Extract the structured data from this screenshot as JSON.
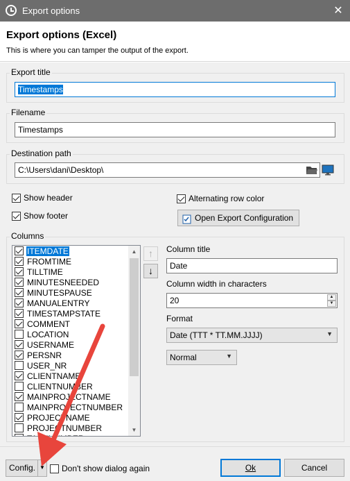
{
  "window": {
    "title": "Export options",
    "close_glyph": "✕"
  },
  "header": {
    "title": "Export options (Excel)",
    "description": "This is where you can tamper the output of the export."
  },
  "export_title": {
    "label": "Export title",
    "value": "Timestamps"
  },
  "filename": {
    "label": "Filename",
    "value": "Timestamps"
  },
  "destination": {
    "label": "Destination path",
    "value": "C:\\Users\\dani\\Desktop\\"
  },
  "options": {
    "show_header": "Show header",
    "show_footer": "Show footer",
    "alternating_row_color": "Alternating row color",
    "open_export_config": "Open Export Configuration"
  },
  "columns": {
    "label": "Columns",
    "items": [
      {
        "name": "ITEMDATE",
        "checked": true,
        "selected": true
      },
      {
        "name": "FROMTIME",
        "checked": true
      },
      {
        "name": "TILLTIME",
        "checked": true
      },
      {
        "name": "MINUTESNEEDED",
        "checked": true
      },
      {
        "name": "MINUTESPAUSE",
        "checked": true
      },
      {
        "name": "MANUALENTRY",
        "checked": true
      },
      {
        "name": "TIMESTAMPSTATE",
        "checked": true
      },
      {
        "name": "COMMENT",
        "checked": true
      },
      {
        "name": "LOCATION",
        "checked": false
      },
      {
        "name": "USERNAME",
        "checked": true
      },
      {
        "name": "PERSNR",
        "checked": true
      },
      {
        "name": "USER_NR",
        "checked": false
      },
      {
        "name": "CLIENTNAME",
        "checked": true
      },
      {
        "name": "CLIENTNUMBER",
        "checked": false
      },
      {
        "name": "MAINPROJECTNAME",
        "checked": true
      },
      {
        "name": "MAINPROJECTNUMBER",
        "checked": false
      },
      {
        "name": "PROJECTNAME",
        "checked": true
      },
      {
        "name": "PROJECTNUMBER",
        "checked": false
      },
      {
        "name": "TASKNUMBER",
        "checked": false
      }
    ]
  },
  "column_settings": {
    "title_label": "Column title",
    "title_value": "Date",
    "width_label": "Column width in characters",
    "width_value": "20",
    "format_label": "Format",
    "format_value": "Date (TTT * TT.MM.JJJJ)",
    "style_value": "Normal"
  },
  "footer": {
    "config_button": "Config.",
    "dont_show_again": "Don't show dialog again",
    "ok": "Ok",
    "cancel": "Cancel"
  },
  "icons": {
    "app": "clock-icon",
    "folder": "folder-open-icon",
    "monitor": "monitor-icon",
    "config": "config-file-icon",
    "move_up": "arrow-up-icon",
    "move_down": "arrow-down-icon"
  },
  "colors": {
    "accent": "#0078d7",
    "titlebar": "#6d6d6d",
    "annotation_arrow": "#e8453c"
  }
}
